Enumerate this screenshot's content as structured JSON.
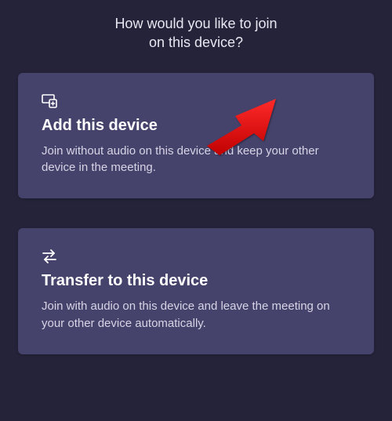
{
  "heading": {
    "line1": "How would you like to join",
    "line2": "on this device?"
  },
  "cards": {
    "add": {
      "icon": "add-device-icon",
      "title": "Add this device",
      "desc": "Join without audio on this device and keep your other device in the meeting."
    },
    "transfer": {
      "icon": "transfer-icon",
      "title": "Transfer to this device",
      "desc": "Join with audio on this device and leave the meeting on your other device automatically."
    }
  },
  "annotation": {
    "type": "red-arrow",
    "color": "#e11b1b"
  }
}
